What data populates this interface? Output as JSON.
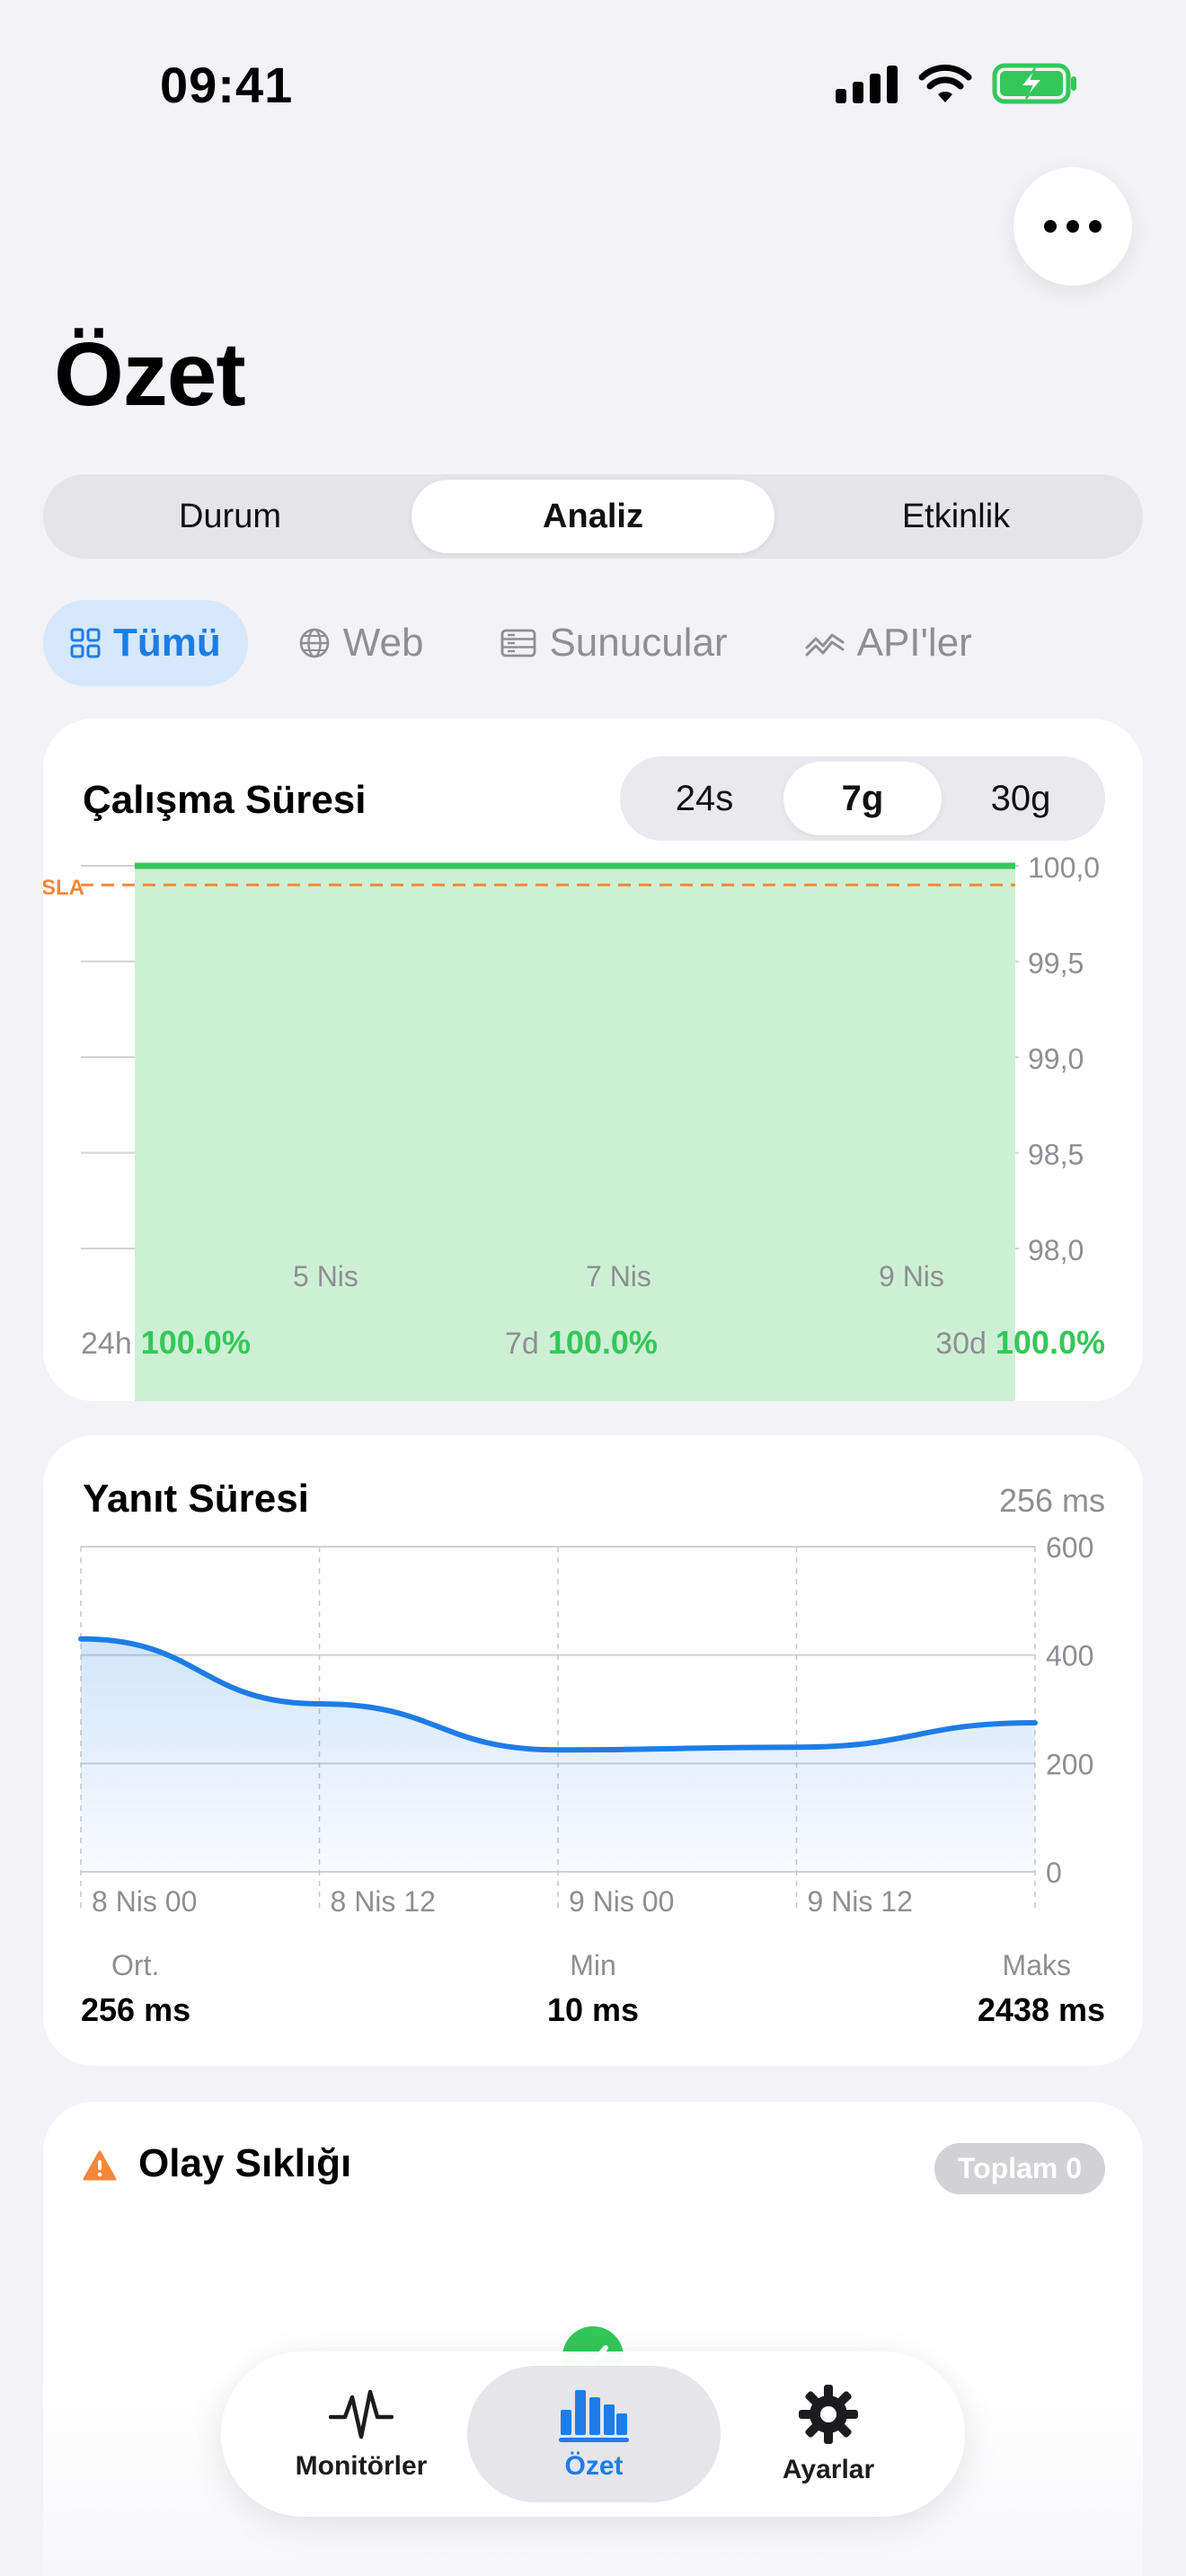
{
  "status_bar": {
    "time": "09:41"
  },
  "header": {
    "title": "Özet",
    "more_icon": "ellipsis-icon"
  },
  "tabs": [
    {
      "label": "Durum",
      "active": false
    },
    {
      "label": "Analiz",
      "active": true
    },
    {
      "label": "Etkinlik",
      "active": false
    }
  ],
  "filters": [
    {
      "label": "Tümü",
      "icon": "grid-icon",
      "active": true
    },
    {
      "label": "Web",
      "icon": "globe-icon",
      "active": false
    },
    {
      "label": "Sunucular",
      "icon": "server-icon",
      "active": false
    },
    {
      "label": "API'ler",
      "icon": "api-icon",
      "active": false
    }
  ],
  "uptime": {
    "title": "Çalışma Süresi",
    "ranges": [
      "24s",
      "7g",
      "30g"
    ],
    "active_range": "7g",
    "sla_label": "SLA",
    "stats": [
      {
        "label": "24h",
        "value": "100.0%"
      },
      {
        "label": "7d",
        "value": "100.0%"
      },
      {
        "label": "30d",
        "value": "100.0%"
      }
    ]
  },
  "response": {
    "title": "Yanıt Süresi",
    "current": "256 ms",
    "stats": [
      {
        "label": "Ort.",
        "value": "256 ms"
      },
      {
        "label": "Min",
        "value": "10 ms"
      },
      {
        "label": "Maks",
        "value": "2438 ms"
      }
    ]
  },
  "incidents": {
    "title": "Olay Sıklığı",
    "total_badge": "Toplam 0",
    "icon": "warning-icon"
  },
  "tabbar": [
    {
      "label": "Monitörler",
      "icon": "waveform-icon",
      "active": false
    },
    {
      "label": "Özet",
      "icon": "chart-bar-icon",
      "active": true
    },
    {
      "label": "Ayarlar",
      "icon": "gear-icon",
      "active": false
    }
  ],
  "colors": {
    "accent": "#1E7CE6",
    "green": "#34C759",
    "green_fill": "#CDF0D5",
    "sla": "#F5873A",
    "background": "#F2F2F7"
  },
  "chart_data": [
    {
      "type": "area",
      "title": "Çalışma Süresi",
      "x": [
        "5 Nis",
        "7 Nis",
        "9 Nis"
      ],
      "series": [
        {
          "values": [
            100.0,
            100.0,
            100.0
          ]
        }
      ],
      "y_ticks": [
        "100,0",
        "99,5",
        "99,0",
        "98,5",
        "98,0"
      ],
      "ylim": [
        98.0,
        100.0
      ],
      "sla": 99.9,
      "grid": true
    },
    {
      "type": "line",
      "title": "Yanıt Süresi",
      "x": [
        "8 Nis 00",
        "8 Nis 12",
        "9 Nis 00",
        "9 Nis 12"
      ],
      "series": [
        {
          "values": [
            430,
            310,
            225,
            230,
            275
          ]
        }
      ],
      "y_ticks": [
        "600",
        "400",
        "200",
        "0"
      ],
      "ylim": [
        0,
        600
      ],
      "grid": true
    }
  ]
}
